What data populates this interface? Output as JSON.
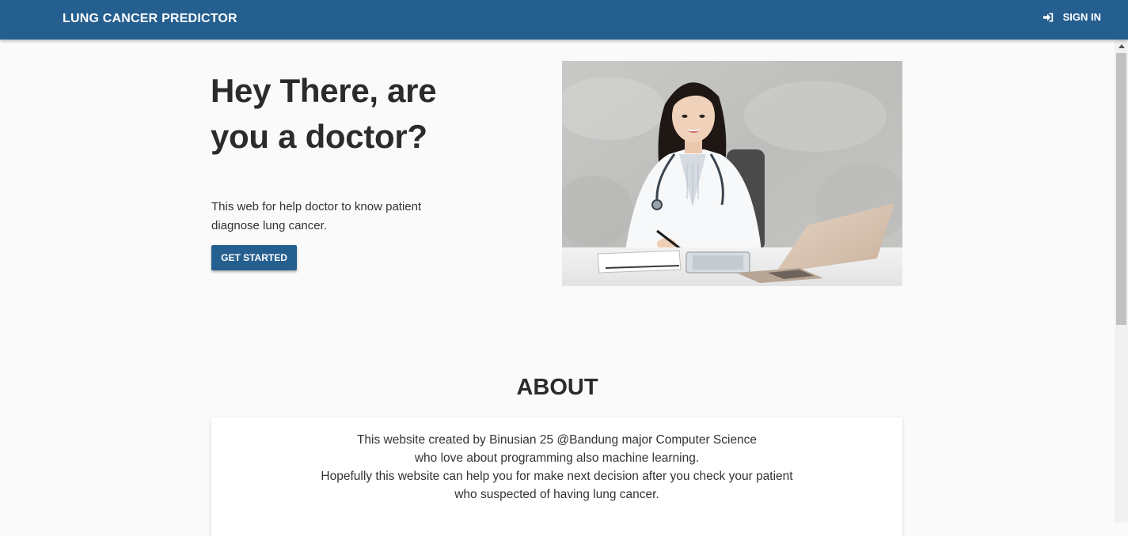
{
  "navbar": {
    "brand": "LUNG CANCER PREDICTOR",
    "signin_label": "SIGN IN",
    "signin_icon": "sign-in-icon",
    "color": "#255f8f"
  },
  "hero": {
    "title": "Hey There, are you a doctor?",
    "description": "This web for help doctor to know patient diagnose lung cancer.",
    "cta_label": "GET STARTED",
    "image": "smiling female doctor in white coat with stethoscope at desk with laptop"
  },
  "about": {
    "title": "ABOUT",
    "lines": [
      "This website created by Binusian 25 @Bandung major Computer Science",
      "who love about programming also machine learning.",
      "Hopefully this website can help you for make next decision after you check your patient",
      "who suspected of having lung cancer."
    ]
  }
}
